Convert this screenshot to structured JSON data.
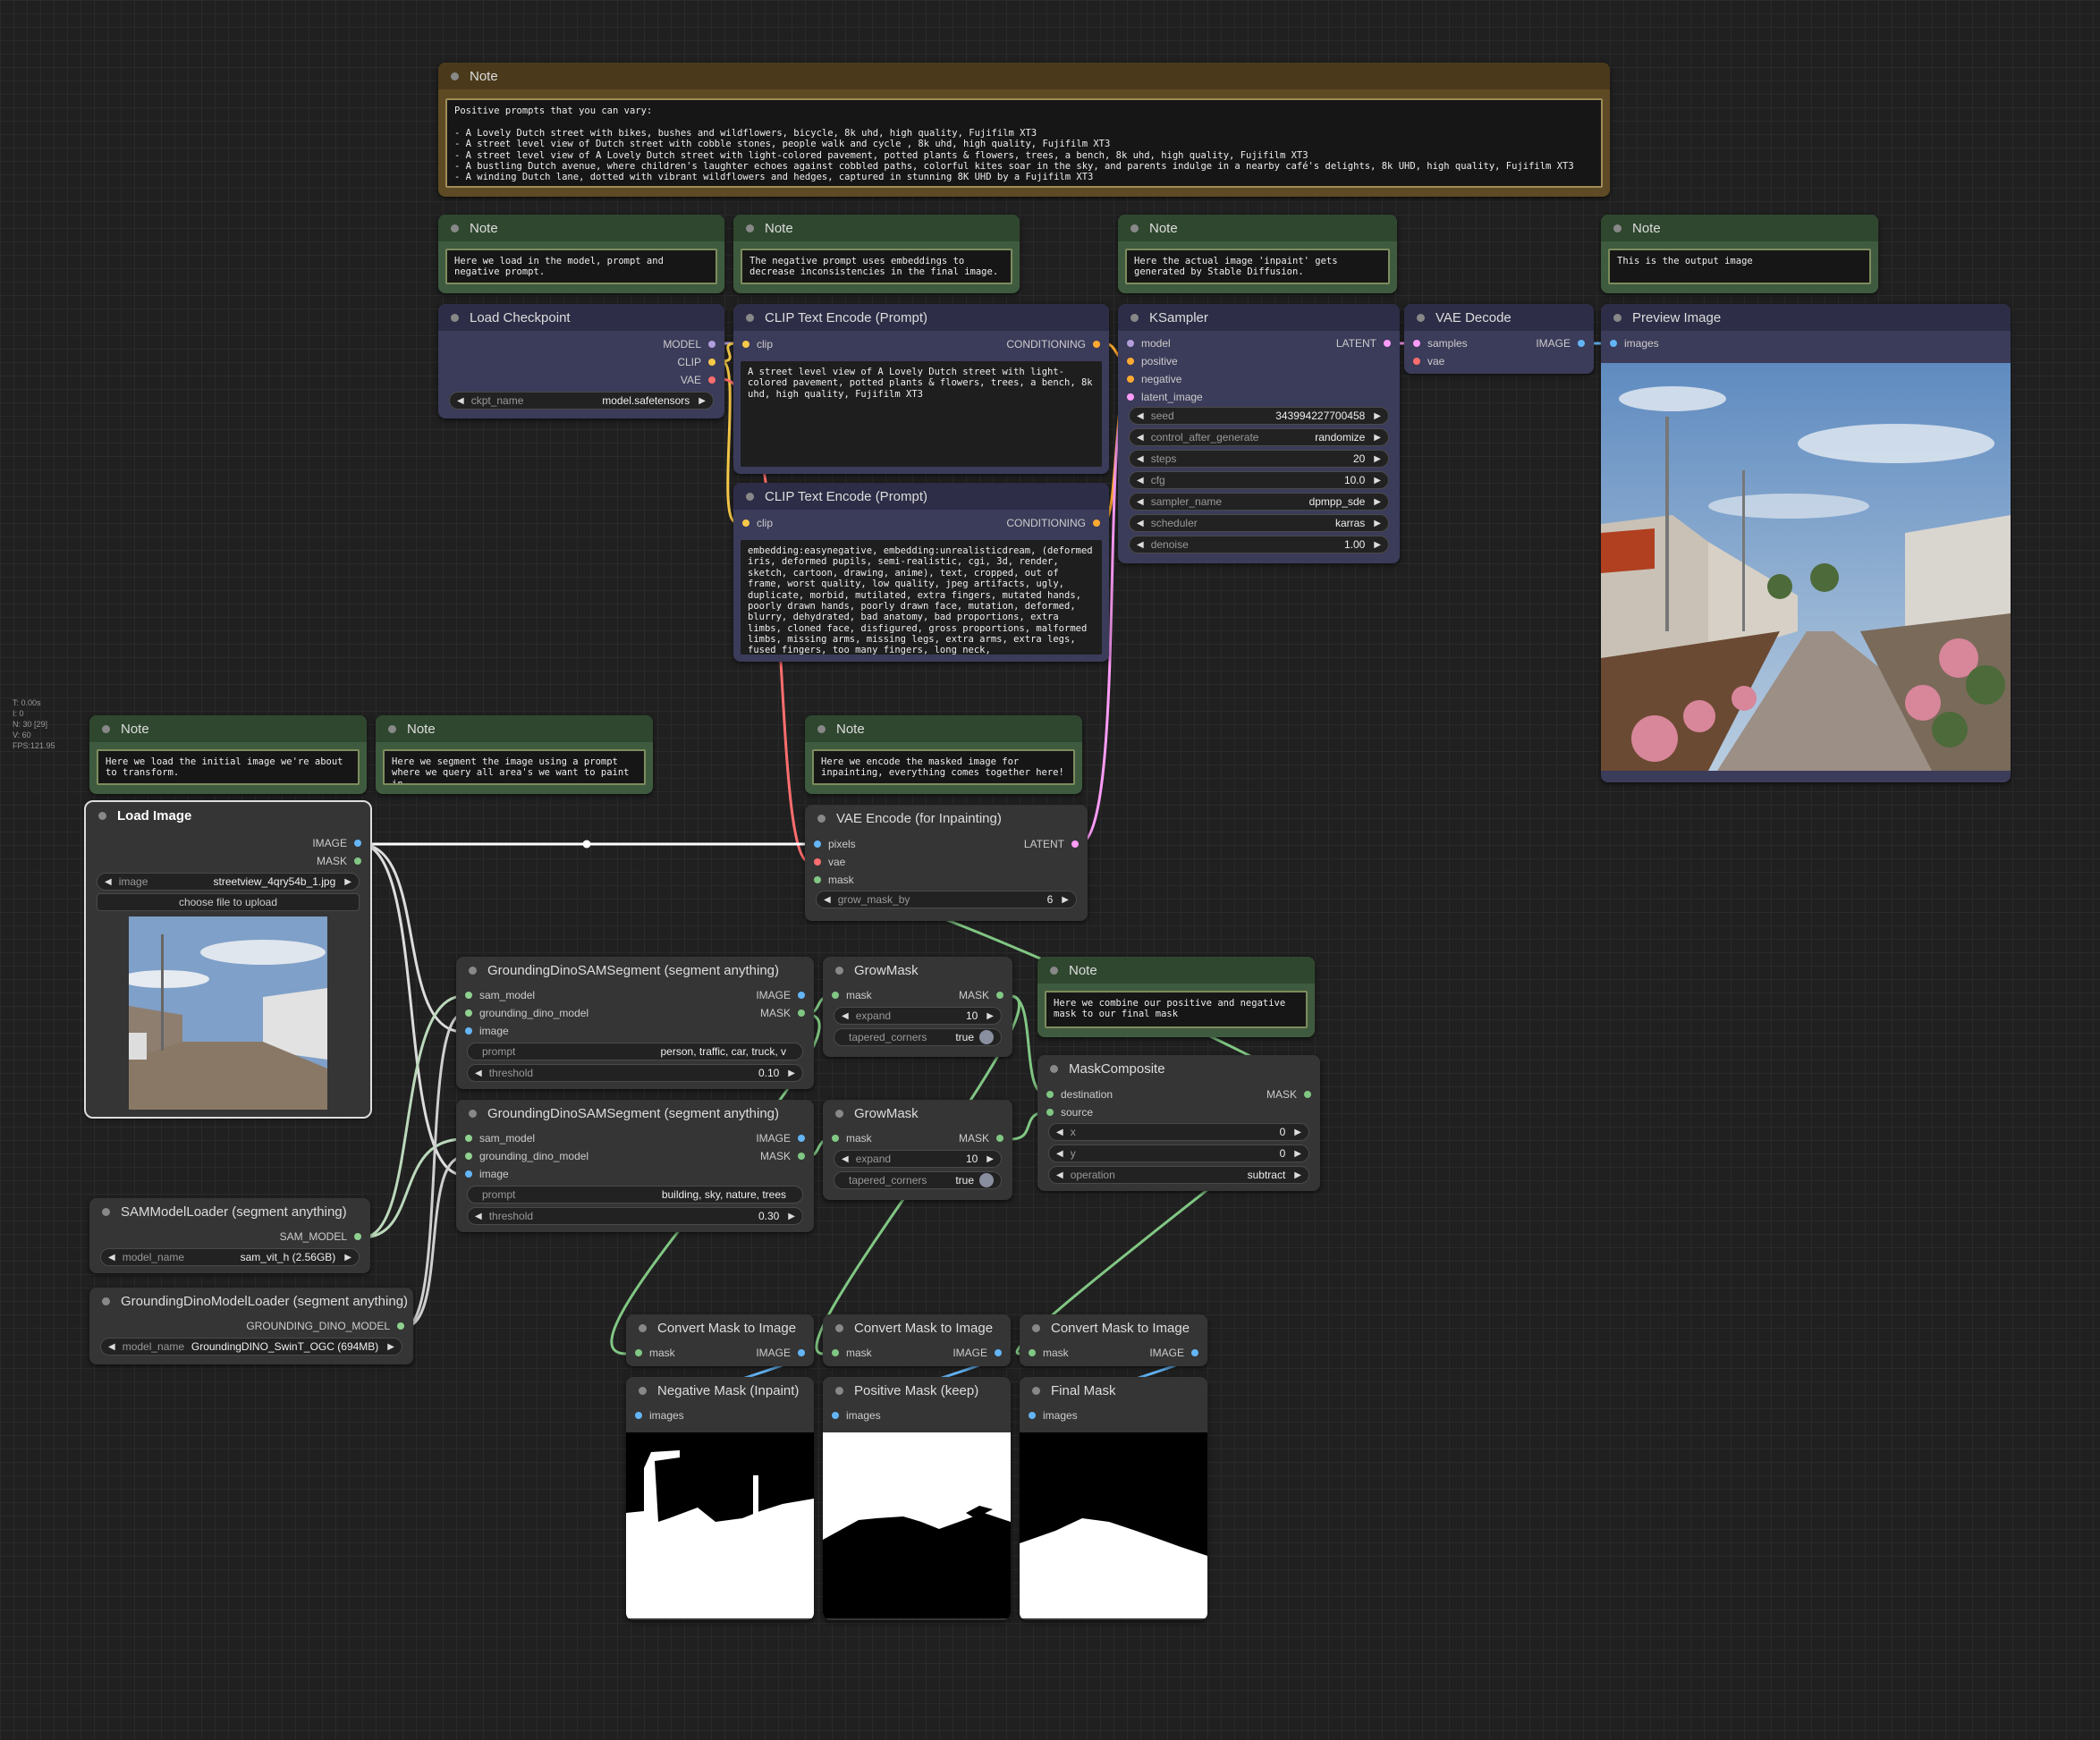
{
  "stats": {
    "t": "T: 0.00s",
    "i": "I: 0",
    "n": "N: 30 [29]",
    "v": "V: 60",
    "fps": "FPS:121.95"
  },
  "notes": {
    "prompts": {
      "title": "Note",
      "text": "Positive prompts that you can vary:\n\n- A Lovely Dutch street with bikes, bushes and wildflowers, bicycle, 8k uhd, high quality, Fujifilm XT3\n- A street level view of Dutch street with cobble stones, people walk and cycle , 8k uhd, high quality, Fujifilm XT3\n- A street level view of A Lovely Dutch street with light-colored pavement, potted plants & flowers, trees, a bench, 8k uhd, high quality, Fujifilm XT3\n- A bustling Dutch avenue, where children's laughter echoes against cobbled paths, colorful kites soar in the sky, and parents indulge in a nearby café's delights, 8k UHD, high quality, Fujifilm XT3\n- A winding Dutch lane, dotted with vibrant wildflowers and hedges, captured in stunning 8K UHD by a Fujifilm XT3"
    },
    "model": {
      "title": "Note",
      "text": "Here we load in the model, prompt and negative prompt."
    },
    "negative": {
      "title": "Note",
      "text": "The negative prompt uses embeddings to decrease inconsistencies in the final image."
    },
    "inpaint": {
      "title": "Note",
      "text": "Here the actual image 'inpaint' gets generated by Stable Diffusion."
    },
    "output": {
      "title": "Note",
      "text": "This is the output image"
    },
    "initial": {
      "title": "Note",
      "text": "Here we load the initial image we're about to transform."
    },
    "segment": {
      "title": "Note",
      "text": "Here we segment the image using a prompt where we query all area's we want to paint in."
    },
    "encode": {
      "title": "Note",
      "text": "Here we encode the masked image for inpainting, everything comes together here!"
    },
    "combine": {
      "title": "Note",
      "text": "Here we combine our positive and negative mask to our final mask"
    }
  },
  "load_checkpoint": {
    "title": "Load Checkpoint",
    "out_model": "MODEL",
    "out_clip": "CLIP",
    "out_vae": "VAE",
    "w_label": "ckpt_name",
    "w_value": "model.safetensors"
  },
  "clip_pos": {
    "title": "CLIP Text Encode (Prompt)",
    "in_clip": "clip",
    "out": "CONDITIONING",
    "text": "A street level view of A Lovely Dutch street with light-colored pavement, potted plants & flowers, trees, a bench, 8k uhd, high quality, Fujifilm XT3"
  },
  "clip_neg": {
    "title": "CLIP Text Encode (Prompt)",
    "in_clip": "clip",
    "out": "CONDITIONING",
    "text": "embedding:easynegative, embedding:unrealisticdream, (deformed iris, deformed pupils, semi-realistic, cgi, 3d, render, sketch, cartoon, drawing, anime), text, cropped, out of frame, worst quality, low quality, jpeg artifacts, ugly, duplicate, morbid, mutilated, extra fingers, mutated hands, poorly drawn hands, poorly drawn face, mutation, deformed, blurry, dehydrated, bad anatomy, bad proportions, extra limbs, cloned face, disfigured, gross proportions, malformed limbs, missing arms, missing legs, extra arms, extra legs, fused fingers, too many fingers, long neck,"
  },
  "ksampler": {
    "title": "KSampler",
    "in_model": "model",
    "in_positive": "positive",
    "in_negative": "negative",
    "in_latent": "latent_image",
    "out": "LATENT",
    "widgets": [
      {
        "label": "seed",
        "value": "343994227700458"
      },
      {
        "label": "control_after_generate",
        "value": "randomize"
      },
      {
        "label": "steps",
        "value": "20"
      },
      {
        "label": "cfg",
        "value": "10.0"
      },
      {
        "label": "sampler_name",
        "value": "dpmpp_sde"
      },
      {
        "label": "scheduler",
        "value": "karras"
      },
      {
        "label": "denoise",
        "value": "1.00"
      }
    ]
  },
  "vae_decode": {
    "title": "VAE Decode",
    "in_samples": "samples",
    "in_vae": "vae",
    "out": "IMAGE"
  },
  "preview": {
    "title": "Preview Image",
    "in_images": "images"
  },
  "load_image": {
    "title": "Load Image",
    "out_image": "IMAGE",
    "out_mask": "MASK",
    "w_label": "image",
    "w_value": "streetview_4qry54b_1.jpg",
    "upload": "choose file to upload"
  },
  "vae_encode": {
    "title": "VAE Encode (for Inpainting)",
    "in_pixels": "pixels",
    "in_vae": "vae",
    "in_mask": "mask",
    "out": "LATENT",
    "w_label": "grow_mask_by",
    "w_value": "6"
  },
  "gdsam1": {
    "title": "GroundingDinoSAMSegment (segment anything)",
    "in_sam": "sam_model",
    "in_gd": "grounding_dino_model",
    "in_image": "image",
    "out_image": "IMAGE",
    "out_mask": "MASK",
    "prompt_label": "prompt",
    "prompt_value": "person, traffic, car, truck, v",
    "th_label": "threshold",
    "th_value": "0.10"
  },
  "gdsam2": {
    "title": "GroundingDinoSAMSegment (segment anything)",
    "in_sam": "sam_model",
    "in_gd": "grounding_dino_model",
    "in_image": "image",
    "out_image": "IMAGE",
    "out_mask": "MASK",
    "prompt_label": "prompt",
    "prompt_value": "building, sky, nature, trees",
    "th_label": "threshold",
    "th_value": "0.30"
  },
  "grow1": {
    "title": "GrowMask",
    "in_mask": "mask",
    "out": "MASK",
    "e_label": "expand",
    "e_value": "10",
    "t_label": "tapered_corners",
    "t_value": "true"
  },
  "grow2": {
    "title": "GrowMask",
    "in_mask": "mask",
    "out": "MASK",
    "e_label": "expand",
    "e_value": "10",
    "t_label": "tapered_corners",
    "t_value": "true"
  },
  "composite": {
    "title": "MaskComposite",
    "in_dest": "destination",
    "in_src": "source",
    "out": "MASK",
    "x_label": "x",
    "x_value": "0",
    "y_label": "y",
    "y_value": "0",
    "op_label": "operation",
    "op_value": "subtract"
  },
  "sam_loader": {
    "title": "SAMModelLoader (segment anything)",
    "out": "SAM_MODEL",
    "w_label": "model_name",
    "w_value": "sam_vit_h (2.56GB)"
  },
  "gd_loader": {
    "title": "GroundingDinoModelLoader (segment anything)",
    "out": "GROUNDING_DINO_MODEL",
    "w_label": "model_name",
    "w_value": "GroundingDINO_SwinT_OGC (694MB)"
  },
  "cmi1": {
    "title": "Convert Mask to Image",
    "in_mask": "mask",
    "out": "IMAGE"
  },
  "cmi2": {
    "title": "Convert Mask to Image",
    "in_mask": "mask",
    "out": "IMAGE"
  },
  "cmi3": {
    "title": "Convert Mask to Image",
    "in_mask": "mask",
    "out": "IMAGE"
  },
  "neg_mask": {
    "title": "Negative Mask (Inpaint)",
    "in_images": "images"
  },
  "pos_mask": {
    "title": "Positive Mask (keep)",
    "in_images": "images"
  },
  "final_mask": {
    "title": "Final Mask",
    "in_images": "images"
  },
  "colors": {
    "model": "#b39ddb",
    "clip": "#f7c948",
    "vae": "#ff6e6e",
    "conditioning": "#ffa931",
    "latent": "#ff9cf9",
    "image": "#64b5f6",
    "mask": "#81c784",
    "sam": "#8fd18f",
    "node": "#353535",
    "note": "#3f5b3f"
  }
}
